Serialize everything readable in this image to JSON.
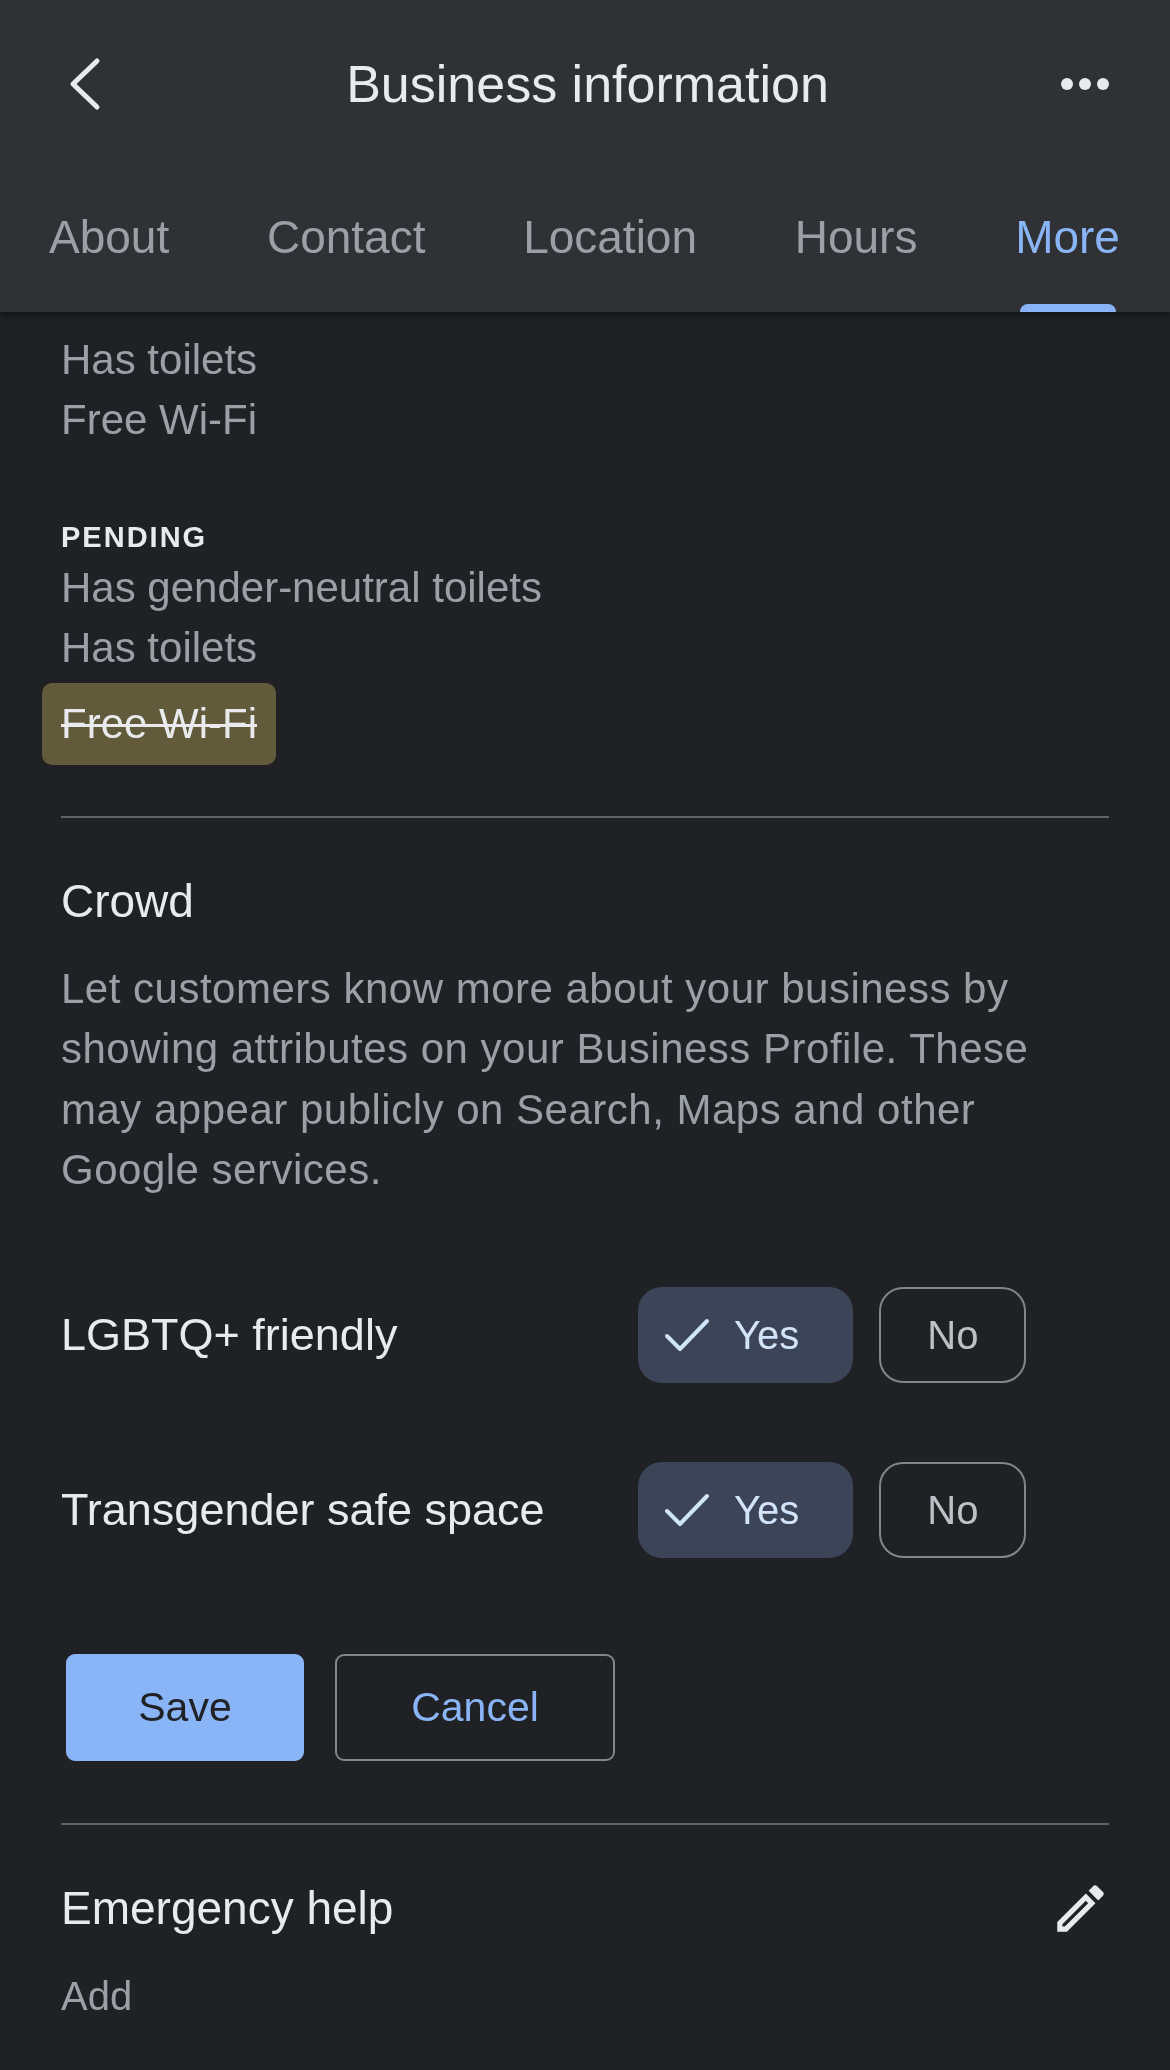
{
  "header": {
    "title": "Business information"
  },
  "tabs": [
    {
      "label": "About",
      "selected": false
    },
    {
      "label": "Contact",
      "selected": false
    },
    {
      "label": "Location",
      "selected": false
    },
    {
      "label": "Hours",
      "selected": false
    },
    {
      "label": "More",
      "selected": true
    }
  ],
  "attributes": {
    "values": [
      "Has toilets",
      "Free Wi-Fi"
    ],
    "pending_label": "PENDING",
    "pending": [
      {
        "text": "Has gender-neutral toilets",
        "removed": false
      },
      {
        "text": "Has toilets",
        "removed": false
      },
      {
        "text": "Free Wi-Fi",
        "removed": true
      }
    ]
  },
  "crowd": {
    "title": "Crowd",
    "description": "Let customers know more about your business by showing attributes on your Business Profile. These may appear publicly on Search, Maps and other Google services.",
    "questions": [
      {
        "label": "LGBTQ+ friendly",
        "options": [
          {
            "label": "Yes",
            "selected": true
          },
          {
            "label": "No",
            "selected": false
          }
        ]
      },
      {
        "label": "Transgender safe space",
        "options": [
          {
            "label": "Yes",
            "selected": true
          },
          {
            "label": "No",
            "selected": false
          }
        ]
      }
    ]
  },
  "actions": [
    {
      "label": "Save",
      "kind": "primary"
    },
    {
      "label": "Cancel",
      "kind": "secondary"
    }
  ],
  "emergency_help": {
    "title": "Emergency help",
    "value": "Add"
  }
}
